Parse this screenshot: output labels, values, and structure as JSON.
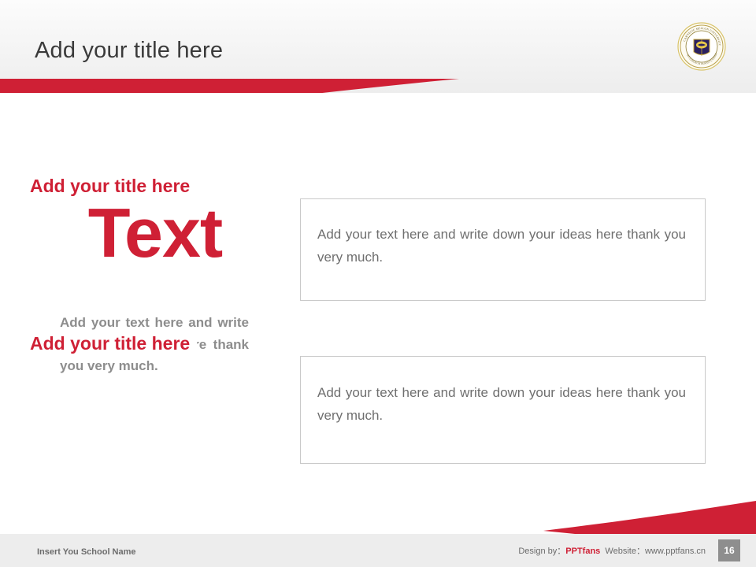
{
  "header": {
    "title": "Add your title here"
  },
  "logo": {
    "name": "carnegie-mellon-university-seal",
    "outer_text_top": "CARNEGIE MELLON UNIVERSITY",
    "outer_text_bottom": "PITTSBURGH PENNSYLVANIA"
  },
  "left": {
    "headline": "Text",
    "paragraph": "Add your text here and write down your ideas here thank you very much."
  },
  "boxes": [
    {
      "title": "Add your title here",
      "text": "Add your text here and write down your ideas here thank you very much."
    },
    {
      "title": "Add your title here",
      "text": "Add your text here and write down your ideas here thank you very much."
    }
  ],
  "footer": {
    "school_name": "Insert You School Name",
    "design_by_label": "Design by：",
    "design_by_value": "PPTfans",
    "website_label": "Website：",
    "website_value": "www.pptfans.cn",
    "page_number": "16"
  },
  "colors": {
    "accent_red": "#cf2035",
    "title_gray": "#3a3a3a",
    "body_gray": "#6f6f6f",
    "muted_gray": "#8d8d8d",
    "footer_bg": "#ededed",
    "page_badge": "#8e8e8e"
  }
}
